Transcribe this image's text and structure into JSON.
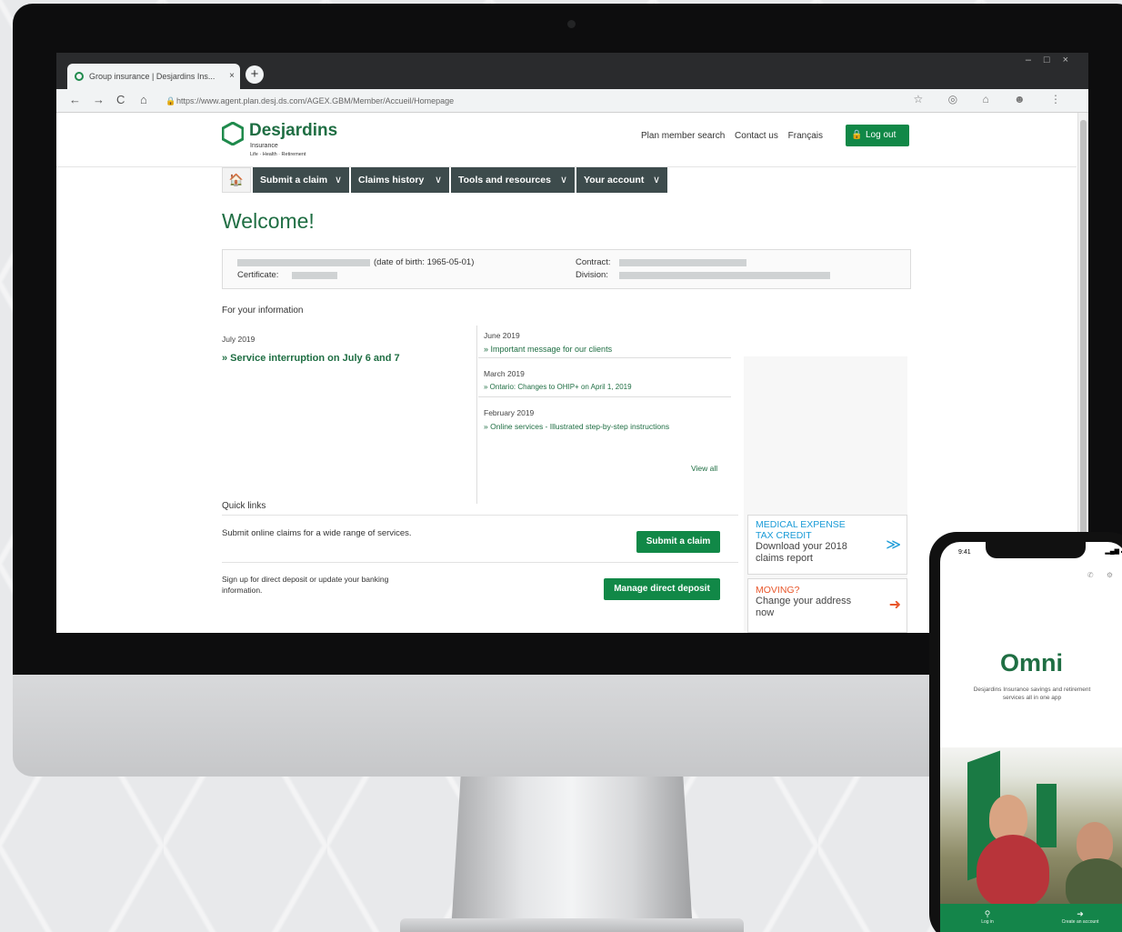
{
  "browser": {
    "tab_title": "Group insurance | Desjardins Ins...",
    "tab_close": "×",
    "new_tab": "+",
    "window_controls": "–□×",
    "url": "https://www.agent.plan.desj.ds.com/AGEX.GBM/Member/Accueil/Homepage",
    "nav": {
      "back": "←",
      "forward": "→",
      "reload": "C",
      "home": "⌂"
    },
    "bar_icons": "☆ ◎ ⌂ ☻ ⋮"
  },
  "header": {
    "logo_name": "Desjardins",
    "logo_sub": "Insurance",
    "logo_tag": "Life · Health · Retirement",
    "links": [
      "Plan member search",
      "Contact us",
      "Français"
    ],
    "logout": "Log out"
  },
  "nav": {
    "home_icon": "🏠",
    "items": [
      "Submit a claim",
      "Claims history",
      "Tools and resources",
      "Your account"
    ],
    "chevron": "∨"
  },
  "welcome": "Welcome!",
  "member": {
    "dob": "(date of birth: 1965-05-01)",
    "certificate_label": "Certificate:",
    "contract_label": "Contract:",
    "division_label": "Division:"
  },
  "info": {
    "title": "For your information",
    "left": {
      "date": "July 2019",
      "link": "» Service interruption on July 6 and 7"
    },
    "right": [
      {
        "date": "June 2019",
        "link": "» Important message for our clients"
      },
      {
        "date": "March 2019",
        "link": "» Ontario: Changes to OHIP+ on April 1, 2019"
      },
      {
        "date": "February 2019",
        "link": "» Online services - Illustrated step-by-step instructions"
      }
    ],
    "view_all": "View all"
  },
  "quick_links": {
    "title": "Quick links",
    "rows": [
      {
        "text": "Submit online claims for a wide range of services.",
        "button": "Submit a claim"
      },
      {
        "text": "Sign up for direct deposit or update your banking",
        "text2": "information.",
        "button": "Manage direct deposit"
      }
    ]
  },
  "promos": [
    {
      "title1": "MEDICAL EXPENSE",
      "title2": "TAX CREDIT",
      "line1": "Download your 2018",
      "line2": "claims report",
      "icon": "≫",
      "color": "#1a9bd7"
    },
    {
      "title1": "MOVING?",
      "line1": "Change your address",
      "line2": "now",
      "icon": "➜",
      "color": "#e8562a"
    }
  ],
  "phone": {
    "time": "9:41",
    "status": "▂▄▆ ▬",
    "top_icons": "✆ ⚙",
    "app_name": "Omni",
    "tagline": "Desjardins Insurance savings and retirement services all in one app",
    "bottom": [
      {
        "icon": "⚲",
        "label": "Log in"
      },
      {
        "icon": "➜",
        "label": "Create an account"
      }
    ]
  }
}
